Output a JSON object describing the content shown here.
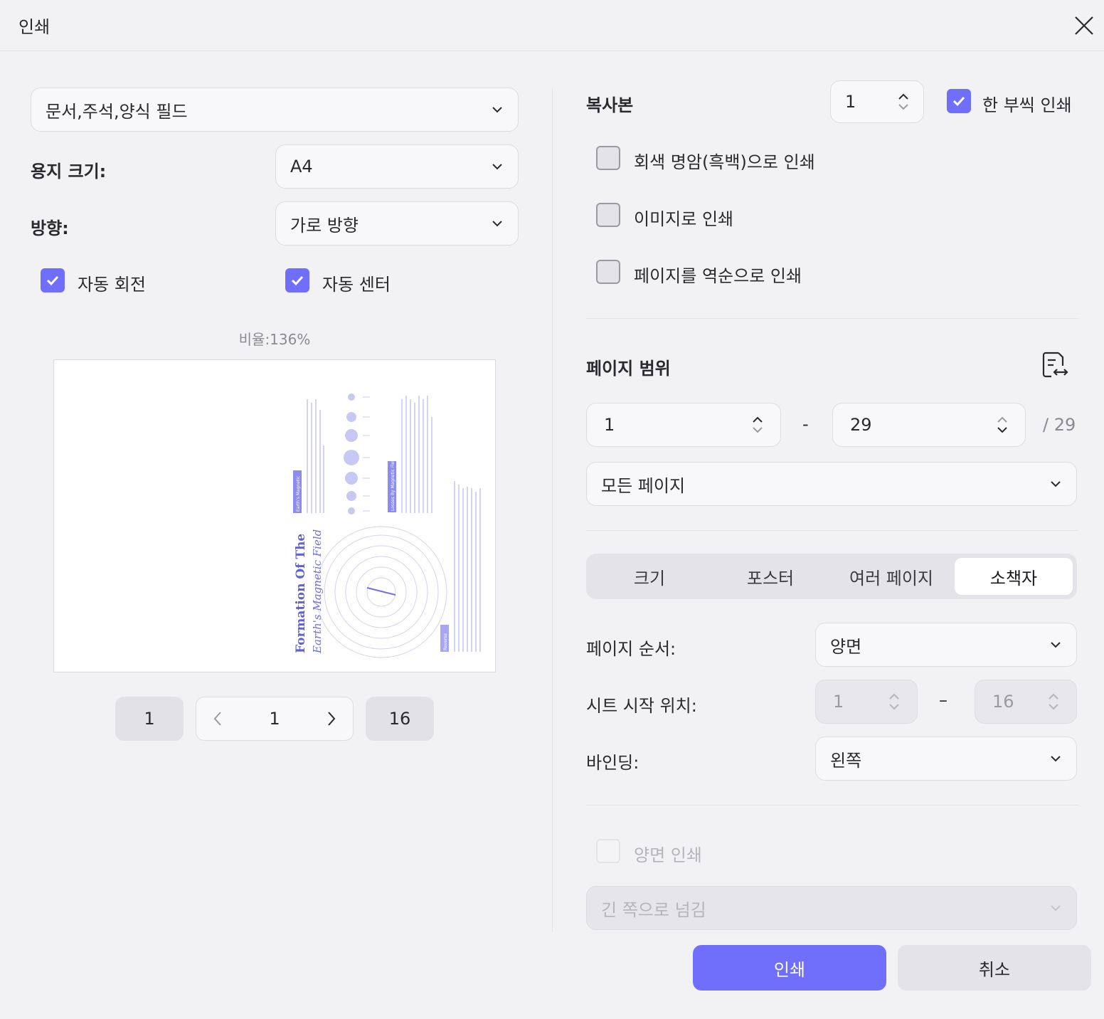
{
  "dialog": {
    "title": "인쇄"
  },
  "left": {
    "content_select": "문서,주석,양식 필드",
    "paper_size_label": "용지 크기:",
    "paper_size_value": "A4",
    "orientation_label": "방향:",
    "orientation_value": "가로 방향",
    "auto_rotate": {
      "label": "자동 회전",
      "checked": true
    },
    "auto_center": {
      "label": "자동 센터",
      "checked": true
    },
    "scale_text": "비율:136%",
    "preview": {
      "title_line1": "Formation Of The",
      "title_line2": "Earth's Magnetic Field",
      "tag1": "Earth's Magnetic",
      "tag2": "Losses By Magnetic Field",
      "tag3": "Reverse"
    },
    "pager": {
      "first": "1",
      "current": "1",
      "last": "16"
    }
  },
  "right": {
    "copies_label": "복사본",
    "copies_value": "1",
    "collate": {
      "label": "한 부씩 인쇄",
      "checked": true
    },
    "grayscale": {
      "label": "회색 명암(흑백)으로 인쇄",
      "checked": false
    },
    "as_image": {
      "label": "이미지로 인쇄",
      "checked": false
    },
    "reverse": {
      "label": "페이지를 역순으로 인쇄",
      "checked": false
    },
    "page_range_title": "페이지 범위",
    "range_from": "1",
    "range_dash": "-",
    "range_to": "29",
    "range_total": "/ 29",
    "page_subset": "모든 페이지",
    "tabs": [
      "크기",
      "포스터",
      "여러 페이지",
      "소책자"
    ],
    "active_tab": "소책자",
    "page_order_label": "페이지 순서:",
    "page_order_value": "양면",
    "sheet_start_label": "시트 시작 위치:",
    "sheet_from": "1",
    "sheet_dash": "–",
    "sheet_to": "16",
    "binding_label": "바인딩:",
    "binding_value": "왼쪽",
    "duplex": {
      "label": "양면 인쇄",
      "checked": false,
      "disabled": true
    },
    "flip_value": "긴 쪽으로 넘김"
  },
  "buttons": {
    "print": "인쇄",
    "cancel": "취소"
  },
  "colors": {
    "accent": "#6f6ffb",
    "background": "#f2f2f4"
  }
}
